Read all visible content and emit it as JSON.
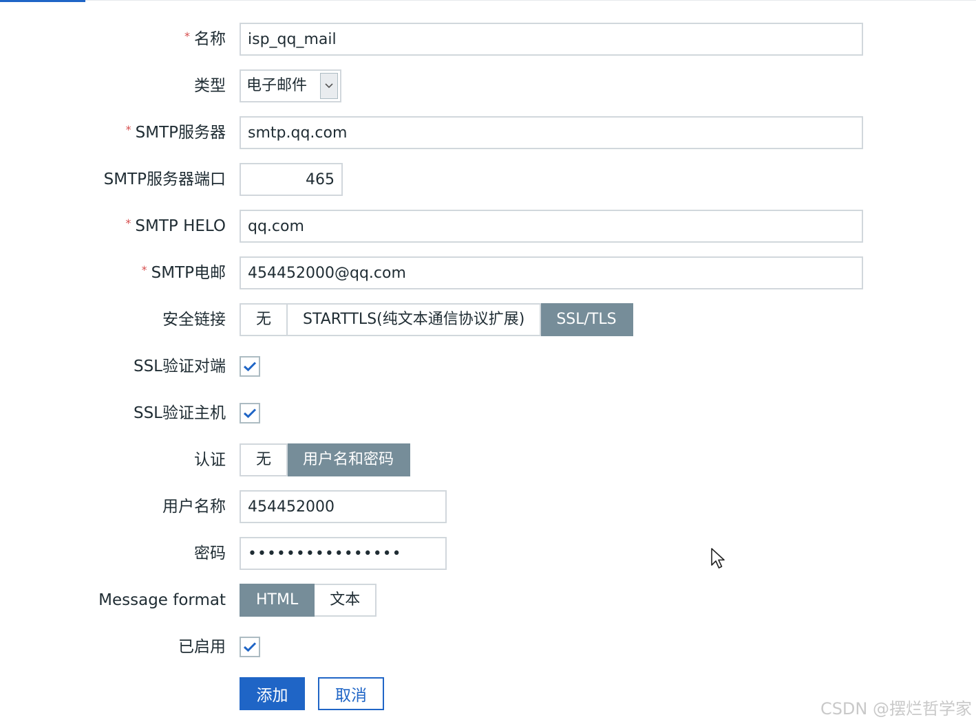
{
  "form": {
    "name": {
      "label": "名称",
      "required": true,
      "value": "isp_qq_mail"
    },
    "type": {
      "label": "类型",
      "selected": "电子邮件"
    },
    "smtp_server": {
      "label": "SMTP服务器",
      "required": true,
      "value": "smtp.qq.com"
    },
    "smtp_port": {
      "label": "SMTP服务器端口",
      "value": "465"
    },
    "smtp_helo": {
      "label": "SMTP HELO",
      "required": true,
      "value": "qq.com"
    },
    "smtp_email": {
      "label": "SMTP电邮",
      "required": true,
      "value": "454452000@qq.com"
    },
    "security": {
      "label": "安全链接",
      "options": [
        "无",
        "STARTTLS(纯文本通信协议扩展)",
        "SSL/TLS"
      ],
      "selected": "SSL/TLS"
    },
    "ssl_verify_peer": {
      "label": "SSL验证对端",
      "checked": true
    },
    "ssl_verify_host": {
      "label": "SSL验证主机",
      "checked": true
    },
    "auth": {
      "label": "认证",
      "options": [
        "无",
        "用户名和密码"
      ],
      "selected": "用户名和密码"
    },
    "username": {
      "label": "用户名称",
      "value": "454452000"
    },
    "password": {
      "label": "密码",
      "value": "••••••••••••••••"
    },
    "message_format": {
      "label": "Message format",
      "options": [
        "HTML",
        "文本"
      ],
      "selected": "HTML"
    },
    "enabled": {
      "label": "已启用",
      "checked": true
    }
  },
  "buttons": {
    "add": "添加",
    "cancel": "取消"
  },
  "required_mark": "*",
  "watermark": "CSDN @摆烂哲学家",
  "icons": {
    "checkbox": "checkmark-icon",
    "select": "chevron-down-icon",
    "cursor": "mouse-pointer-icon"
  },
  "colors": {
    "primary": "#1f65c6",
    "segment_active": "#768d99",
    "required": "#d64e4e",
    "check": "#1f65c6"
  }
}
